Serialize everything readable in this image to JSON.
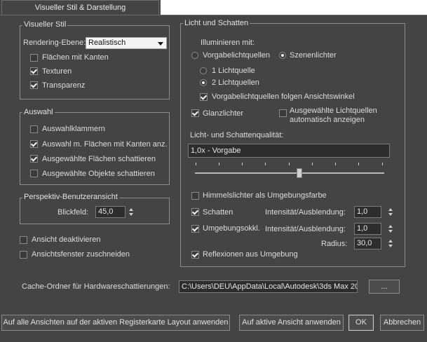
{
  "tabs": [
    {
      "label": "Visueller Stil & Darstellung"
    }
  ],
  "visual_style": {
    "title": "Visueller Stil",
    "render_level_label": "Rendering-Ebene:",
    "render_level_value": "Realistisch",
    "options": [
      {
        "label": "Flächen mit Kanten",
        "checked": false
      },
      {
        "label": "Texturen",
        "checked": true
      },
      {
        "label": "Transparenz",
        "checked": true
      }
    ]
  },
  "selection": {
    "title": "Auswahl",
    "options": [
      {
        "label": "Auswahlklammern",
        "checked": false
      },
      {
        "label": "Auswahl m. Flächen mit Kanten anz.",
        "checked": true
      },
      {
        "label": "Ausgewählte Flächen schattieren",
        "checked": true
      },
      {
        "label": "Ausgewählte Objekte schattieren",
        "checked": false
      }
    ]
  },
  "perspective": {
    "title": "Perspektiv-Benutzeransicht",
    "fov_label": "Blickfeld:",
    "fov_value": "45,0"
  },
  "view_options": [
    {
      "label": "Ansicht deaktivieren",
      "checked": false
    },
    {
      "label": "Ansichtsfenster zuschneiden",
      "checked": false
    }
  ],
  "lighting": {
    "title": "Licht und Schatten",
    "illuminate_label": "Illuminieren mit:",
    "default_lights": {
      "label": "Vorgabelichtquellen",
      "selected": false
    },
    "scene_lights": {
      "label": "Szenenlichter",
      "selected": true
    },
    "one_light": {
      "label": "1 Lichtquelle",
      "selected": false
    },
    "two_lights": {
      "label": "2 Lichtquellen",
      "selected": true
    },
    "follow_view": {
      "label": "Vorgabelichtquellen folgen Ansichtswinkel",
      "checked": true
    },
    "highlights": {
      "label": "Glanzlichter",
      "checked": true
    },
    "auto_show": {
      "label_line1": "Ausgewählte Lichtquellen",
      "label_line2": "automatisch anzeigen",
      "checked": false
    },
    "quality_label": "Licht- und Schattenqualität:",
    "quality_value": "1,0x - Vorgabe",
    "quality_slider_fraction": 0.55,
    "sky_lights": {
      "label": "Himmelslichter als Umgebungsfarbe",
      "checked": false
    },
    "shadows": {
      "label": "Schatten",
      "checked": true,
      "intensity_label": "Intensität/Ausblendung:",
      "intensity_value": "1,0"
    },
    "ambient_occlusion": {
      "label": "Umgebungsokkl.",
      "checked": true,
      "intensity_label": "Intensität/Ausblendung:",
      "intensity_value": "1,0",
      "radius_label": "Radius:",
      "radius_value": "30,0"
    },
    "reflections": {
      "label": "Reflexionen aus Umgebung",
      "checked": true
    }
  },
  "cache": {
    "label": "Cache-Ordner für Hardwareschattierungen:",
    "path": "C:\\Users\\DEU\\AppData\\Local\\Autodesk\\3ds Max 20",
    "browse_label": "..."
  },
  "buttons": {
    "apply_all": "Auf alle Ansichten auf der aktiven Registerkarte Layout anwenden",
    "apply_active": "Auf aktive Ansicht anwenden",
    "ok": "OK",
    "cancel": "Abbrechen"
  }
}
